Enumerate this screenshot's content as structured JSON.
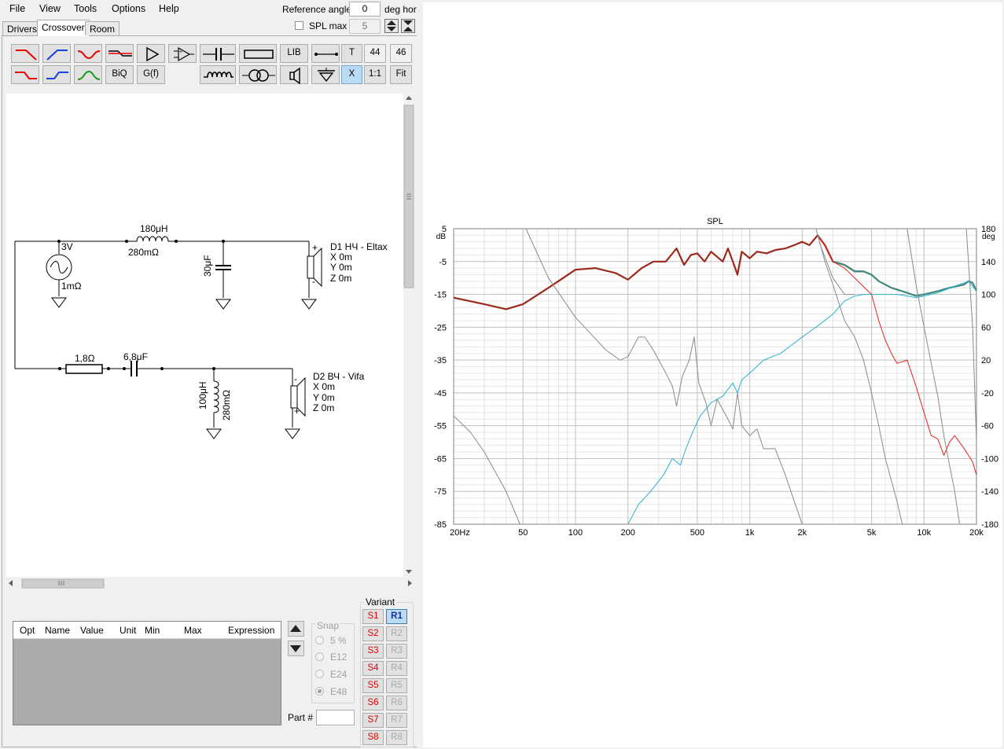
{
  "menu": {
    "file": "File",
    "view": "View",
    "tools": "Tools",
    "options": "Options",
    "help": "Help"
  },
  "top": {
    "reference_angle_label": "Reference angle",
    "reference_angle_value": "0",
    "reference_angle_unit": "deg hor",
    "spl_max_label": "SPL max",
    "spl_max_value": "5"
  },
  "tabs": [
    "Drivers",
    "Crossover",
    "Room"
  ],
  "active_tab": "Crossover",
  "toolbar": {
    "biq": "BiQ",
    "gf": "G(f)",
    "lib": "LIB",
    "t": "T",
    "x": "X",
    "ratio": "1:1",
    "fit": "Fit",
    "num1": "44",
    "num2": "46"
  },
  "schematic": {
    "src1_voltage": "3V",
    "src1_res": "1mΩ",
    "l1_value": "180μH",
    "l1_res": "280mΩ",
    "c1_value": "30μF",
    "d1_name": "D1 НЧ - Eltax",
    "d1_x": "X  0m",
    "d1_y": "Y  0m",
    "d1_z": "Z  0m",
    "r1_value": "1,8Ω",
    "c2_value": "6,8μF",
    "l2_value": "100μH",
    "l2_res": "280mΩ",
    "d2_name": "D2 ВЧ - Vifa",
    "d2_x": "X  0m",
    "d2_y": "Y  0m",
    "d2_z": "Z  0m",
    "plus": "+",
    "minus": "-"
  },
  "table": {
    "headers": [
      "Opt",
      "Name",
      "Value",
      "Unit",
      "Min",
      "Max",
      "Expression"
    ]
  },
  "snap": {
    "label": "Snap",
    "options": [
      "5 %",
      "E12",
      "E24",
      "E48"
    ],
    "selected": "E48"
  },
  "part": {
    "label": "Part #"
  },
  "variant": {
    "label": "Variant",
    "s": [
      "S1",
      "S2",
      "S3",
      "S4",
      "S5",
      "S6",
      "S7",
      "S8"
    ],
    "r": [
      "R1",
      "R2",
      "R3",
      "R4",
      "R5",
      "R6",
      "R7",
      "R8"
    ],
    "active_r": "R1"
  },
  "colors": {
    "sum": "#9b2a1a",
    "lowpass": "#e8201a",
    "highpass": "#29b2d6",
    "gray": "#8a8a8a",
    "final": "#3f8a7c"
  },
  "chart_data": {
    "type": "line",
    "title": "SPL",
    "ylabel_left": "dB",
    "ylabel_right": "deg",
    "x_scale": "log",
    "xlim": [
      20,
      20000
    ],
    "ylim_left": [
      -85,
      5
    ],
    "ylim_right": [
      -180,
      180
    ],
    "x_ticks": [
      "20Hz",
      "50",
      "100",
      "200",
      "500",
      "1k",
      "2k",
      "5k",
      "10k",
      "20k"
    ],
    "x_tick_values": [
      20,
      50,
      100,
      200,
      500,
      1000,
      2000,
      5000,
      10000,
      20000
    ],
    "y_ticks_left": [
      "5",
      "-5",
      "-15",
      "-25",
      "-35",
      "-45",
      "-55",
      "-65",
      "-75",
      "-85"
    ],
    "y_ticks_left_values": [
      5,
      -5,
      -15,
      -25,
      -35,
      -45,
      -55,
      -65,
      -75,
      -85
    ],
    "y_ticks_right": [
      "180",
      "140",
      "100",
      "60",
      "20",
      "-20",
      "-60",
      "-100",
      "-140",
      "-180"
    ],
    "y_ticks_right_values": [
      180,
      140,
      100,
      60,
      20,
      -20,
      -60,
      -100,
      -140,
      -180
    ],
    "grid": true,
    "series": [
      {
        "color": "#9b2a1a",
        "width": 2.2,
        "points": [
          [
            20,
            -16
          ],
          [
            30,
            -18
          ],
          [
            40,
            -19.5
          ],
          [
            50,
            -18
          ],
          [
            70,
            -13
          ],
          [
            100,
            -7.5
          ],
          [
            130,
            -7
          ],
          [
            170,
            -8.5
          ],
          [
            200,
            -10.5
          ],
          [
            240,
            -7
          ],
          [
            280,
            -5
          ],
          [
            330,
            -5
          ],
          [
            380,
            -1
          ],
          [
            420,
            -6
          ],
          [
            460,
            -3
          ],
          [
            500,
            -2.5
          ],
          [
            550,
            -5
          ],
          [
            600,
            -2
          ],
          [
            700,
            -5
          ],
          [
            750,
            -1
          ],
          [
            800,
            -5
          ],
          [
            850,
            -9
          ],
          [
            900,
            -2
          ],
          [
            1000,
            -4
          ],
          [
            1100,
            -2
          ],
          [
            1250,
            -2.5
          ],
          [
            1400,
            -1.5
          ],
          [
            1600,
            -1
          ],
          [
            1800,
            0
          ],
          [
            2000,
            1
          ],
          [
            2200,
            0
          ],
          [
            2450,
            3
          ],
          [
            2700,
            0
          ],
          [
            3000,
            -5
          ],
          [
            3500,
            -6
          ],
          [
            4000,
            -8
          ],
          [
            4500,
            -8
          ]
        ]
      },
      {
        "color": "#3f8a7c",
        "width": 2.2,
        "points": [
          [
            3000,
            -5
          ],
          [
            3500,
            -6
          ],
          [
            4000,
            -8
          ],
          [
            4500,
            -8
          ],
          [
            5000,
            -9
          ],
          [
            5500,
            -11
          ],
          [
            6500,
            -13
          ],
          [
            8000,
            -14.5
          ],
          [
            9000,
            -15.5
          ],
          [
            10000,
            -15
          ],
          [
            12000,
            -14
          ],
          [
            14000,
            -13
          ],
          [
            17000,
            -12
          ],
          [
            18000,
            -11
          ],
          [
            19000,
            -11.5
          ],
          [
            20000,
            -14
          ]
        ]
      },
      {
        "color": "#e8201a",
        "width": 1,
        "points": [
          [
            2450,
            3
          ],
          [
            2700,
            0
          ],
          [
            3000,
            -5
          ],
          [
            3500,
            -7
          ],
          [
            4000,
            -10
          ],
          [
            5000,
            -15
          ],
          [
            5500,
            -23
          ],
          [
            6000,
            -29
          ],
          [
            6500,
            -33
          ],
          [
            7000,
            -36
          ],
          [
            8000,
            -35
          ],
          [
            9000,
            -43
          ],
          [
            10000,
            -51
          ],
          [
            11000,
            -58
          ],
          [
            12000,
            -59
          ],
          [
            13000,
            -64
          ],
          [
            14000,
            -60
          ],
          [
            15000,
            -58
          ],
          [
            17000,
            -62
          ],
          [
            19000,
            -66
          ],
          [
            20000,
            -70
          ]
        ]
      },
      {
        "color": "#29b2d6",
        "width": 1,
        "points": [
          [
            200,
            -85
          ],
          [
            230,
            -79
          ],
          [
            270,
            -75
          ],
          [
            320,
            -70
          ],
          [
            360,
            -65
          ],
          [
            400,
            -67
          ],
          [
            430,
            -62
          ],
          [
            470,
            -57
          ],
          [
            520,
            -52
          ],
          [
            600,
            -48
          ],
          [
            700,
            -46
          ],
          [
            800,
            -42
          ],
          [
            850,
            -45
          ],
          [
            900,
            -41
          ],
          [
            1000,
            -39
          ],
          [
            1200,
            -35
          ],
          [
            1500,
            -33
          ],
          [
            2000,
            -28
          ],
          [
            2400,
            -25
          ],
          [
            3000,
            -21
          ],
          [
            3500,
            -17
          ],
          [
            4000,
            -15.5
          ],
          [
            4500,
            -15
          ],
          [
            5000,
            -15
          ],
          [
            6000,
            -15
          ],
          [
            7000,
            -15
          ],
          [
            8000,
            -15.5
          ],
          [
            9000,
            -16
          ],
          [
            10000,
            -15.5
          ],
          [
            12000,
            -14.5
          ],
          [
            15000,
            -12.5
          ],
          [
            18000,
            -11
          ],
          [
            20000,
            -14
          ]
        ]
      },
      {
        "color": "#8a8a8a",
        "width": 1,
        "points": [
          [
            20,
            -52
          ],
          [
            25,
            -57
          ],
          [
            30,
            -63
          ],
          [
            40,
            -75
          ],
          [
            48,
            -85
          ]
        ]
      },
      {
        "color": "#8a8a8a",
        "width": 1,
        "points": [
          [
            52,
            5
          ],
          [
            70,
            -10
          ],
          [
            100,
            -22
          ],
          [
            150,
            -32
          ],
          [
            180,
            -35
          ],
          [
            200,
            -34
          ],
          [
            230,
            -28
          ],
          [
            250,
            -28
          ],
          [
            280,
            -32
          ],
          [
            330,
            -39
          ],
          [
            360,
            -43
          ],
          [
            380,
            -49
          ],
          [
            410,
            -40
          ],
          [
            450,
            -35
          ],
          [
            480,
            -28
          ],
          [
            510,
            -42
          ],
          [
            560,
            -48
          ],
          [
            600,
            -55
          ],
          [
            650,
            -47
          ],
          [
            750,
            -53
          ],
          [
            800,
            -56
          ],
          [
            850,
            -45
          ],
          [
            900,
            -55
          ],
          [
            1000,
            -58
          ],
          [
            1100,
            -56
          ],
          [
            1200,
            -62
          ],
          [
            1400,
            -62
          ],
          [
            1600,
            -70
          ],
          [
            1800,
            -78
          ],
          [
            2000,
            -85
          ]
        ]
      },
      {
        "color": "#8a8a8a",
        "width": 1,
        "points": [
          [
            2400,
            5
          ],
          [
            2700,
            -5
          ],
          [
            3000,
            -12
          ],
          [
            3500,
            -23
          ],
          [
            4000,
            -28
          ],
          [
            4500,
            -35
          ],
          [
            5000,
            -45
          ],
          [
            5500,
            -55
          ],
          [
            6000,
            -65
          ],
          [
            7000,
            -78
          ],
          [
            7500,
            -85
          ]
        ]
      },
      {
        "color": "#8a8a8a",
        "width": 1,
        "points": [
          [
            2500,
            1
          ],
          [
            3000,
            -10
          ],
          [
            3500,
            -15
          ],
          [
            4000,
            -15
          ]
        ]
      },
      {
        "color": "#8a8a8a",
        "width": 1,
        "points": [
          [
            8000,
            5
          ],
          [
            9000,
            -12
          ],
          [
            10000,
            -25
          ],
          [
            11000,
            -36
          ],
          [
            12000,
            -46
          ],
          [
            13000,
            -58
          ],
          [
            14000,
            -67
          ],
          [
            15000,
            -75
          ],
          [
            16000,
            -85
          ]
        ]
      },
      {
        "color": "#8a8a8a",
        "width": 1,
        "points": [
          [
            17500,
            5
          ],
          [
            19000,
            -25
          ],
          [
            20000,
            -60
          ]
        ]
      }
    ]
  }
}
